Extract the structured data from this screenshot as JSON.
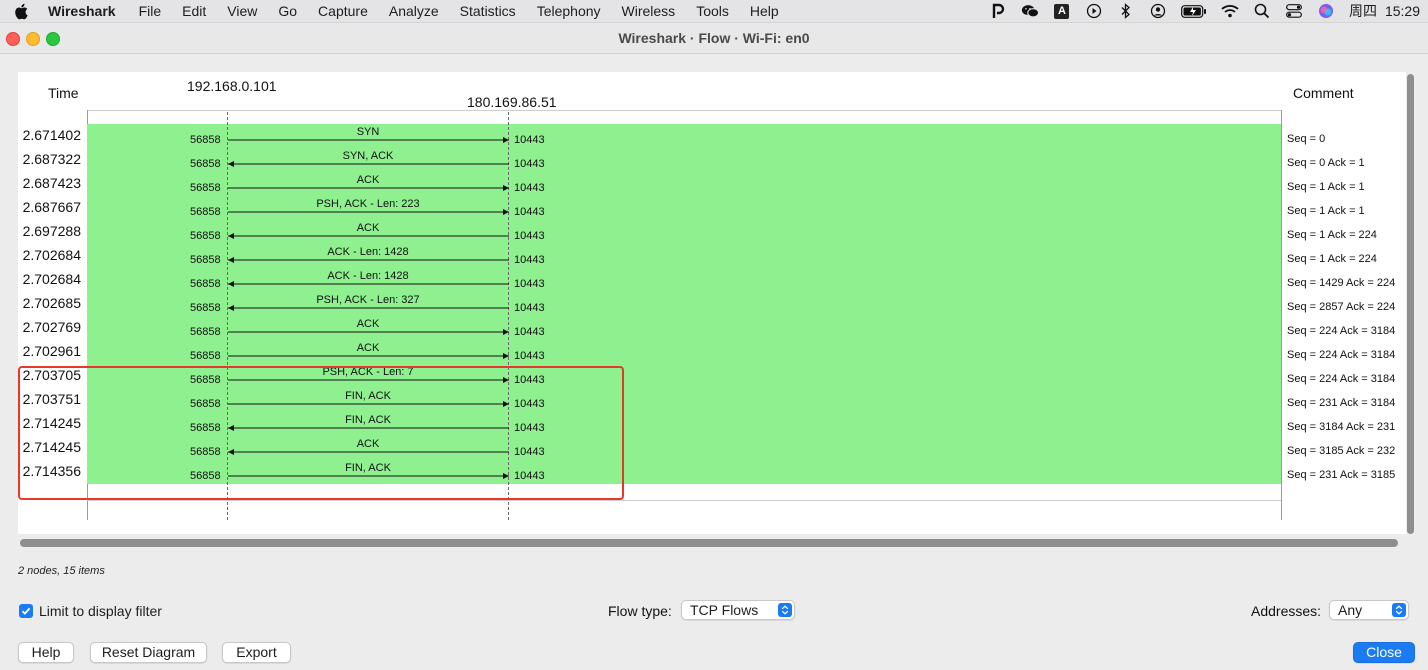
{
  "menubar": {
    "app": "Wireshark",
    "items": [
      "File",
      "Edit",
      "View",
      "Go",
      "Capture",
      "Analyze",
      "Statistics",
      "Telephony",
      "Wireless",
      "Tools",
      "Help"
    ],
    "status": {
      "input_label": "A",
      "day": "周四",
      "time": "15:29"
    }
  },
  "window": {
    "title": "Wireshark · Flow · Wi-Fi: en0"
  },
  "diagram": {
    "time_header": "Time",
    "comment_header": "Comment",
    "node_left": "192.168.0.101",
    "node_right": "180.169.86.51",
    "rows": [
      {
        "time": "2.671402",
        "src_port": "56858",
        "label": "SYN",
        "dst_port": "10443",
        "direction": "right",
        "comment": "Seq = 0"
      },
      {
        "time": "2.687322",
        "src_port": "56858",
        "label": "SYN, ACK",
        "dst_port": "10443",
        "direction": "left",
        "comment": "Seq = 0 Ack = 1"
      },
      {
        "time": "2.687423",
        "src_port": "56858",
        "label": "ACK",
        "dst_port": "10443",
        "direction": "right",
        "comment": "Seq = 1 Ack = 1"
      },
      {
        "time": "2.687667",
        "src_port": "56858",
        "label": "PSH, ACK - Len: 223",
        "dst_port": "10443",
        "direction": "right",
        "comment": "Seq = 1 Ack = 1"
      },
      {
        "time": "2.697288",
        "src_port": "56858",
        "label": "ACK",
        "dst_port": "10443",
        "direction": "left",
        "comment": "Seq = 1 Ack = 224"
      },
      {
        "time": "2.702684",
        "src_port": "56858",
        "label": "ACK - Len: 1428",
        "dst_port": "10443",
        "direction": "left",
        "comment": "Seq = 1 Ack = 224"
      },
      {
        "time": "2.702684",
        "src_port": "56858",
        "label": "ACK - Len: 1428",
        "dst_port": "10443",
        "direction": "left",
        "comment": "Seq = 1429 Ack = 224"
      },
      {
        "time": "2.702685",
        "src_port": "56858",
        "label": "PSH, ACK - Len: 327",
        "dst_port": "10443",
        "direction": "left",
        "comment": "Seq = 2857 Ack = 224"
      },
      {
        "time": "2.702769",
        "src_port": "56858",
        "label": "ACK",
        "dst_port": "10443",
        "direction": "right",
        "comment": "Seq = 224 Ack = 3184"
      },
      {
        "time": "2.702961",
        "src_port": "56858",
        "label": "ACK",
        "dst_port": "10443",
        "direction": "right",
        "comment": "Seq = 224 Ack = 3184"
      },
      {
        "time": "2.703705",
        "src_port": "56858",
        "label": "PSH, ACK - Len: 7",
        "dst_port": "10443",
        "direction": "right",
        "comment": "Seq = 224 Ack = 3184"
      },
      {
        "time": "2.703751",
        "src_port": "56858",
        "label": "FIN, ACK",
        "dst_port": "10443",
        "direction": "right",
        "comment": "Seq = 231 Ack = 3184"
      },
      {
        "time": "2.714245",
        "src_port": "56858",
        "label": "FIN, ACK",
        "dst_port": "10443",
        "direction": "left",
        "comment": "Seq = 3184 Ack = 231"
      },
      {
        "time": "2.714245",
        "src_port": "56858",
        "label": "ACK",
        "dst_port": "10443",
        "direction": "left",
        "comment": "Seq = 3185 Ack = 232"
      },
      {
        "time": "2.714356",
        "src_port": "56858",
        "label": "FIN, ACK",
        "dst_port": "10443",
        "direction": "right",
        "comment": "Seq = 231 Ack = 3185"
      }
    ]
  },
  "summary": "2 nodes, 15 items",
  "controls": {
    "limit_filter_label": "Limit to display filter",
    "limit_filter_checked": true,
    "flow_type_label": "Flow type:",
    "flow_type_value": "TCP Flows",
    "addresses_label": "Addresses:",
    "addresses_value": "Any"
  },
  "buttons": {
    "help": "Help",
    "reset": "Reset Diagram",
    "export": "Export",
    "close": "Close"
  },
  "colors": {
    "flow_band": "#8ef08f",
    "highlight": "#e8382b",
    "accent": "#1a7bf2"
  }
}
